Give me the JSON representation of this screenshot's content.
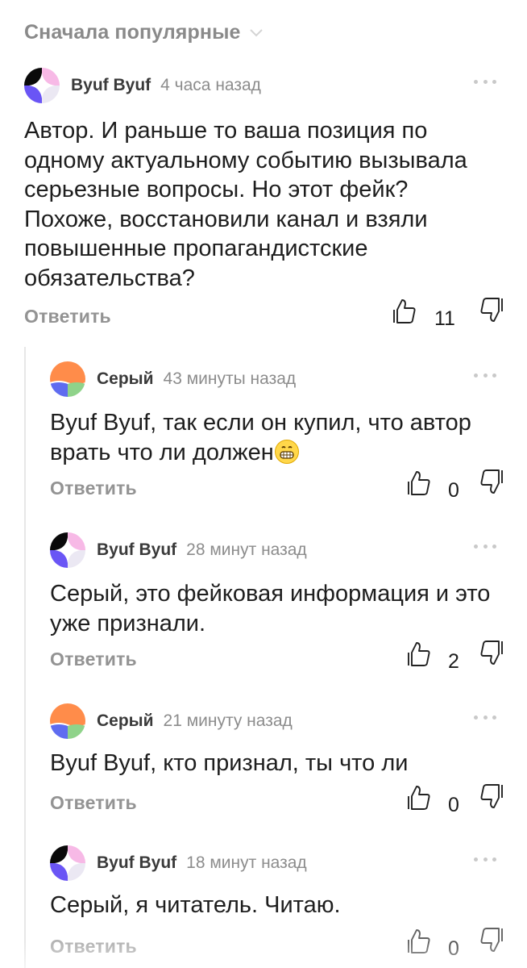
{
  "sort": {
    "label": "Сначала популярные",
    "icon": "chevron-down-icon"
  },
  "comments": [
    {
      "author": "Byuf Byuf",
      "time": "4 часа назад",
      "avatar": "colorful-quadrant-avatar",
      "text": "Автор. И раньше то ваша позиция по одному актуальному событию вызывала серьезные вопросы. Но этот фейк? Похоже, восстановили канал и взяли повышенные пропагандистские обязательства?",
      "reply_label": "Ответить",
      "likes": "11"
    },
    {
      "author": "Серый",
      "time": "43 минуты назад",
      "avatar": "orange-blob-avatar",
      "text": "Byuf Byuf, так если он купил, что автор врать что ли должен",
      "emoji": "grinning-face-emoji",
      "reply_label": "Ответить",
      "likes": "0"
    },
    {
      "author": "Byuf Byuf",
      "time": "28 минут назад",
      "avatar": "colorful-quadrant-avatar",
      "text": "Серый, это фейковая информация и это уже признали.",
      "reply_label": "Ответить",
      "likes": "2"
    },
    {
      "author": "Серый",
      "time": "21 минуту назад",
      "avatar": "orange-blob-avatar",
      "text": "Byuf Byuf, кто признал, ты что ли",
      "reply_label": "Ответить",
      "likes": "0"
    },
    {
      "author": "Byuf Byuf",
      "time": "18 минут назад",
      "avatar": "colorful-quadrant-avatar",
      "text": "Серый, я читатель. Читаю.",
      "reply_label": "Ответить",
      "likes": "0"
    }
  ],
  "colors": {
    "avatar_black": "#0a0a0a",
    "avatar_pink": "#f7b9e6",
    "avatar_violet": "#6a55f5",
    "avatar_light": "#ebe8f3",
    "serый_orange": "#ff8c4a",
    "serый_green": "#8fd38a",
    "serый_blue": "#5f6cf0"
  }
}
